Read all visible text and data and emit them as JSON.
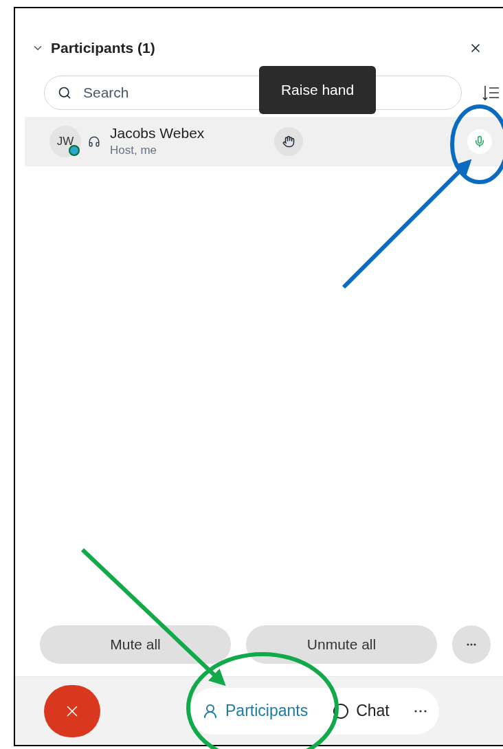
{
  "panel": {
    "title": "Participants (1)"
  },
  "search": {
    "placeholder": "Search"
  },
  "tooltip": "Raise hand",
  "participants": [
    {
      "initials": "JW",
      "name": "Jacobs Webex",
      "role": "Host, me",
      "muted": false
    }
  ],
  "action_buttons": [
    "Mute all",
    "Unmute all"
  ],
  "toolbar": [
    {
      "label": "Participants",
      "kind": "participants",
      "selected": true
    },
    {
      "label": "Chat",
      "kind": "chat",
      "selected": false
    }
  ]
}
